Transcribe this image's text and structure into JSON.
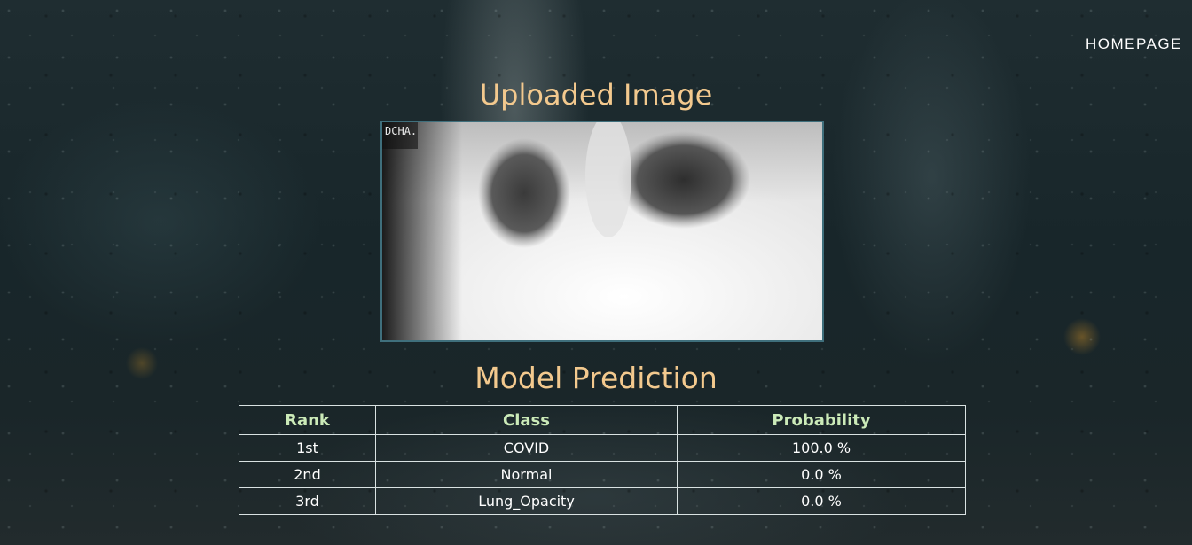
{
  "nav": {
    "homepage_label": "HOMEPAGE"
  },
  "uploaded": {
    "title": "Uploaded Image",
    "image_caption": "DCHA."
  },
  "prediction": {
    "title": "Model Prediction",
    "headers": {
      "rank": "Rank",
      "class": "Class",
      "probability": "Probability"
    },
    "rows": [
      {
        "rank": "1st",
        "class": "COVID",
        "probability": "100.0 %"
      },
      {
        "rank": "2nd",
        "class": "Normal",
        "probability": "0.0 %"
      },
      {
        "rank": "3rd",
        "class": "Lung_Opacity",
        "probability": "0.0 %"
      }
    ]
  },
  "colors": {
    "title": "#f3c98e",
    "table_header": "#cbeab8",
    "image_border": "#3f6f7c"
  }
}
